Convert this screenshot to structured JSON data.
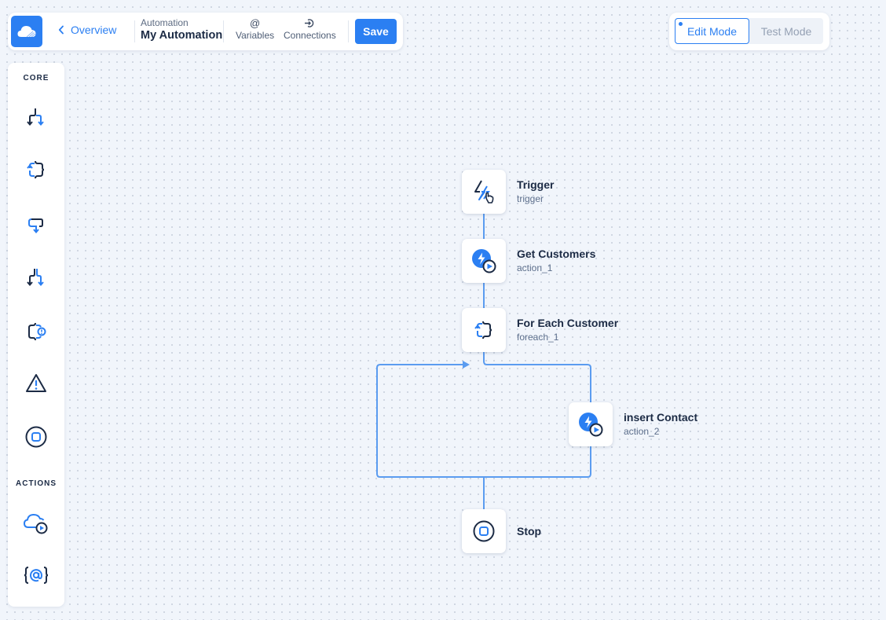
{
  "header": {
    "logo_icon": "cloud-icon",
    "back_label": "Overview",
    "breadcrumb_small": "Automation",
    "title": "My Automation",
    "variables_label": "Variables",
    "variables_icon": "@",
    "connections_label": "Connections",
    "connections_icon": "connection-icon",
    "save_label": "Save"
  },
  "mode_toggle": {
    "options": [
      {
        "label": "Edit Mode",
        "active": true
      },
      {
        "label": "Test Mode",
        "active": false
      }
    ]
  },
  "sidebar": {
    "sections": [
      {
        "header": "CORE",
        "items": [
          {
            "name": "branch",
            "icon": "branch-split-icon"
          },
          {
            "name": "loop",
            "icon": "foreach-loop-icon"
          },
          {
            "name": "while",
            "icon": "while-loop-icon"
          },
          {
            "name": "parallel",
            "icon": "parallel-branch-icon"
          },
          {
            "name": "try-catch",
            "icon": "error-handler-icon"
          },
          {
            "name": "raise-error",
            "icon": "warning-icon"
          },
          {
            "name": "stop",
            "icon": "stop-icon"
          }
        ]
      },
      {
        "header": "ACTIONS",
        "items": [
          {
            "name": "api-action",
            "icon": "cloud-play-icon"
          },
          {
            "name": "variable-action",
            "icon": "variable-braces-icon"
          }
        ]
      }
    ]
  },
  "colors": {
    "accent": "#2b7ff2",
    "dark": "#1c2b45",
    "wire": "#5b9cf0",
    "canvas": "#f1f5fb"
  },
  "flow": {
    "nodes": [
      {
        "id": "trigger",
        "title": "Trigger",
        "subtitle": "trigger",
        "icon": "trigger-bolt-click-icon"
      },
      {
        "id": "action_1",
        "title": "Get Customers",
        "subtitle": "action_1",
        "icon": "action-bolt-play-icon"
      },
      {
        "id": "foreach_1",
        "title": "For Each Customer",
        "subtitle": "foreach_1",
        "icon": "foreach-loop-icon"
      },
      {
        "id": "action_2",
        "title": "insert Contact",
        "subtitle": "action_2",
        "icon": "action-bolt-play-icon"
      },
      {
        "id": "stop",
        "title": "Stop",
        "subtitle": "",
        "icon": "stop-icon"
      }
    ]
  }
}
